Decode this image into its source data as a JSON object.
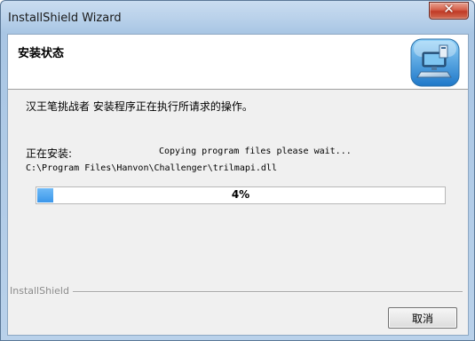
{
  "window": {
    "title": "InstallShield Wizard"
  },
  "header": {
    "title": "安装状态",
    "icon": "installer-computer-icon"
  },
  "body": {
    "status_message": "汉王笔挑战者 安装程序正在执行所请求的操作。",
    "installing_label": "正在安装:",
    "action_text": "Copying program files please wait...",
    "current_file": "C:\\Program Files\\Hanvon\\Challenger\\trilmapi.dll"
  },
  "progress": {
    "percent": 4,
    "label": "4%",
    "fill_color": "#3b97ea"
  },
  "footer": {
    "brand": "InstallShield",
    "cancel_label": "取消"
  },
  "colors": {
    "close_button": "#c8432d",
    "window_frame": "#b9d1ea",
    "dialog_background": "#f0f0f0"
  }
}
